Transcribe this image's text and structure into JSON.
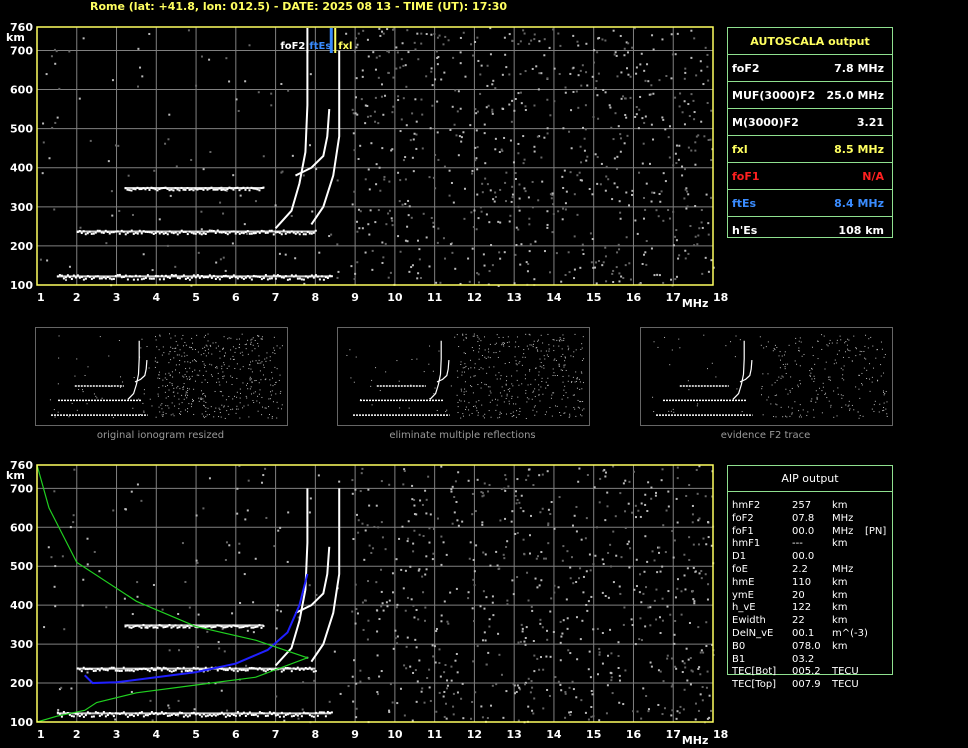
{
  "header": {
    "title": "Rome (lat: +41.8, lon: 012.5) - DATE: 2025 08 13 - TIME (UT): 17:30"
  },
  "axes": {
    "x_ticks": [
      "1",
      "2",
      "3",
      "4",
      "5",
      "6",
      "7",
      "8",
      "9",
      "10",
      "11",
      "12",
      "13",
      "14",
      "15",
      "16",
      "17",
      "18"
    ],
    "x_unit": "MHz",
    "y_ticks": [
      "100",
      "200",
      "300",
      "400",
      "500",
      "600",
      "700",
      "760"
    ],
    "y_unit": "km"
  },
  "markers": {
    "fof2": "foF2",
    "ftes": "ftEs",
    "fxl": "fxl"
  },
  "colors": {
    "grid": "#808080",
    "frame": "#ffff60",
    "trace": "#ffffff",
    "profile_blue": "#2020ff",
    "profile_green": "#20d020",
    "fof1_red": "#ff2020",
    "ftes_blue": "#3a8cff",
    "fxl_yellow": "#ffff60",
    "panel_border": "#8fe08f"
  },
  "autoscala": {
    "title": "AUTOSCALA output",
    "rows": [
      {
        "label": "foF2",
        "value": "7.8 MHz",
        "color": "#ffffff"
      },
      {
        "label": "MUF(3000)F2",
        "value": "25.0 MHz",
        "color": "#ffffff"
      },
      {
        "label": "M(3000)F2",
        "value": "3.21",
        "color": "#ffffff"
      },
      {
        "label": "fxl",
        "value": "8.5 MHz",
        "color": "#ffff60"
      },
      {
        "label": "foF1",
        "value": "N/A",
        "color": "#ff2020"
      },
      {
        "label": "ftEs",
        "value": "8.4 MHz",
        "color": "#3a8cff"
      },
      {
        "label": "h'Es",
        "value": "108 km",
        "color": "#ffffff"
      }
    ]
  },
  "aip": {
    "title": "AIP output",
    "rows": [
      {
        "name": "hmF2",
        "value": "257",
        "unit": "km",
        "extra": ""
      },
      {
        "name": "foF2",
        "value": "07.8",
        "unit": "MHz",
        "extra": ""
      },
      {
        "name": "foF1",
        "value": "00.0",
        "unit": "MHz",
        "extra": "[PN]"
      },
      {
        "name": "hmF1",
        "value": "---",
        "unit": "km",
        "extra": ""
      },
      {
        "name": "D1",
        "value": "00.0",
        "unit": "",
        "extra": ""
      },
      {
        "name": "foE",
        "value": "2.2",
        "unit": "MHz",
        "extra": ""
      },
      {
        "name": "hmE",
        "value": "110",
        "unit": "km",
        "extra": ""
      },
      {
        "name": "ymE",
        "value": "20",
        "unit": "km",
        "extra": ""
      },
      {
        "name": "h_vE",
        "value": "122",
        "unit": "km",
        "extra": ""
      },
      {
        "name": "Ewidth",
        "value": "22",
        "unit": "km",
        "extra": ""
      },
      {
        "name": "DelN_vE",
        "value": "00.1",
        "unit": "m^(-3)",
        "extra": ""
      },
      {
        "name": "B0",
        "value": "078.0",
        "unit": "km",
        "extra": ""
      },
      {
        "name": "B1",
        "value": "03.2",
        "unit": "",
        "extra": ""
      },
      {
        "name": "TEC[Bot]",
        "value": "005.2",
        "unit": "TECU",
        "extra": ""
      },
      {
        "name": "TEC[Top]",
        "value": "007.9",
        "unit": "TECU",
        "extra": ""
      }
    ]
  },
  "thumbnails": [
    {
      "caption": "original ionogram resized"
    },
    {
      "caption": "eliminate multiple reflections"
    },
    {
      "caption": "evidence F2 trace"
    }
  ],
  "chart_data": {
    "type": "scatter",
    "xlabel": "MHz",
    "ylabel": "km",
    "xlim": [
      1,
      18
    ],
    "ylim": [
      100,
      760
    ],
    "grid": true,
    "traces": {
      "es_layer": {
        "x": [
          1.5,
          8.4
        ],
        "y": [
          122,
          122
        ]
      },
      "f_lower": {
        "x": [
          2.0,
          8.0
        ],
        "y": [
          237,
          237
        ]
      },
      "f_second": {
        "x": [
          3.2,
          6.7
        ],
        "y": [
          348,
          348
        ]
      },
      "f2_trace": {
        "x": [
          7.0,
          7.4,
          7.6,
          7.75,
          7.8,
          7.8
        ],
        "y": [
          245,
          290,
          360,
          440,
          560,
          700
        ]
      },
      "f2_second": {
        "x": [
          7.5,
          7.9,
          8.2,
          8.3,
          8.35
        ],
        "y": [
          380,
          400,
          430,
          480,
          550
        ]
      },
      "x_trace": {
        "x": [
          7.9,
          8.2,
          8.45,
          8.6,
          8.6
        ],
        "y": [
          255,
          300,
          380,
          480,
          700
        ]
      }
    },
    "profile_blue": {
      "x": [
        2.2,
        2.4,
        3.0,
        4.0,
        5.0,
        6.0,
        6.8,
        7.3,
        7.6,
        7.8
      ],
      "y": [
        220,
        200,
        202,
        215,
        228,
        250,
        285,
        330,
        400,
        480
      ]
    },
    "profile_green": {
      "x": [
        1.0,
        1.5,
        2.2,
        2.5,
        3.5,
        5.0,
        6.5,
        7.8,
        6.5,
        5.0,
        3.5,
        2.0,
        1.3,
        1.0
      ],
      "y": [
        100,
        115,
        130,
        150,
        175,
        195,
        215,
        265,
        310,
        345,
        410,
        510,
        650,
        760
      ]
    }
  }
}
